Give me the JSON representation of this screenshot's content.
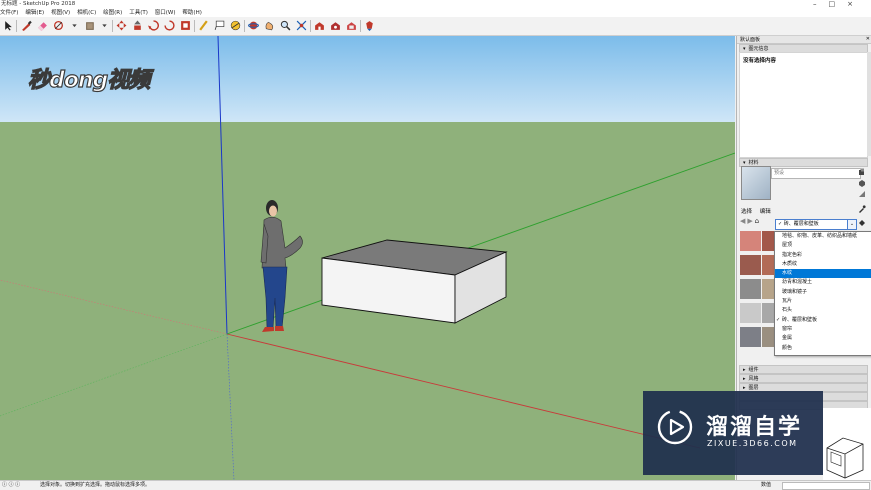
{
  "window": {
    "title": "无标题 - SketchUp Pro 2018",
    "controls": [
      "–",
      "□",
      "×"
    ]
  },
  "menu": [
    "文件(F)",
    "编辑(E)",
    "视图(V)",
    "相机(C)",
    "绘图(R)",
    "工具(T)",
    "窗口(W)",
    "帮助(H)"
  ],
  "toolbar": {
    "icons": [
      "select-arrow-icon",
      "pencil-line-icon",
      "eraser-icon",
      "shape-icon",
      "paint-bucket-icon",
      "move-icon",
      "push-pull-icon",
      "rotate-icon",
      "scale-icon",
      "tape-measure-icon",
      "text-icon",
      "protractor-icon",
      "orbit-icon",
      "pan-icon",
      "zoom-icon",
      "zoom-extents-icon",
      "warehouse-icon",
      "extension-warehouse-icon",
      "layout-icon",
      "ruby-icon"
    ]
  },
  "viewport": {
    "logo": "秒dong视频",
    "colors": {
      "sky": "#8fc8f0",
      "ground": "#8fb17b",
      "blue_axis": "#1a37c8",
      "red_axis": "#c83a3a",
      "green_axis": "#2ea02e"
    }
  },
  "tray": {
    "title": "默认面板",
    "entity_info": {
      "header": "图元信息",
      "text": "没有选择内容"
    },
    "materials": {
      "header": "材料",
      "name_placeholder": "预设",
      "tabs": [
        "选择",
        "编辑"
      ],
      "selected_category": "砖、覆层和壁板",
      "categories": [
        {
          "label": "地毯、织物、皮革、纺织品和墙纸",
          "selected": false,
          "checked": false
        },
        {
          "label": "屋顶",
          "selected": false,
          "checked": false
        },
        {
          "label": "指定色彩",
          "selected": false,
          "checked": false
        },
        {
          "label": "木质纹",
          "selected": false,
          "checked": false
        },
        {
          "label": "水纹",
          "selected": true,
          "checked": false
        },
        {
          "label": "沥青和混凝土",
          "selected": false,
          "checked": false
        },
        {
          "label": "玻璃和镜子",
          "selected": false,
          "checked": false
        },
        {
          "label": "瓦片",
          "selected": false,
          "checked": false
        },
        {
          "label": "石头",
          "selected": false,
          "checked": false
        },
        {
          "label": "砖、覆层和壁板",
          "selected": false,
          "checked": true
        },
        {
          "label": "窗帘",
          "selected": false,
          "checked": false
        },
        {
          "label": "金属",
          "selected": false,
          "checked": false
        },
        {
          "label": "颜色",
          "selected": false,
          "checked": false
        }
      ]
    },
    "collapsed_panels": [
      "组件",
      "风格",
      "图层"
    ]
  },
  "status": {
    "text": "选择对象。切换到扩充选择。拖动鼠标选择多项。",
    "measure_label": "数值"
  },
  "watermark": {
    "title": "溜溜自学",
    "url": "ZIXUE.3D66.COM"
  }
}
